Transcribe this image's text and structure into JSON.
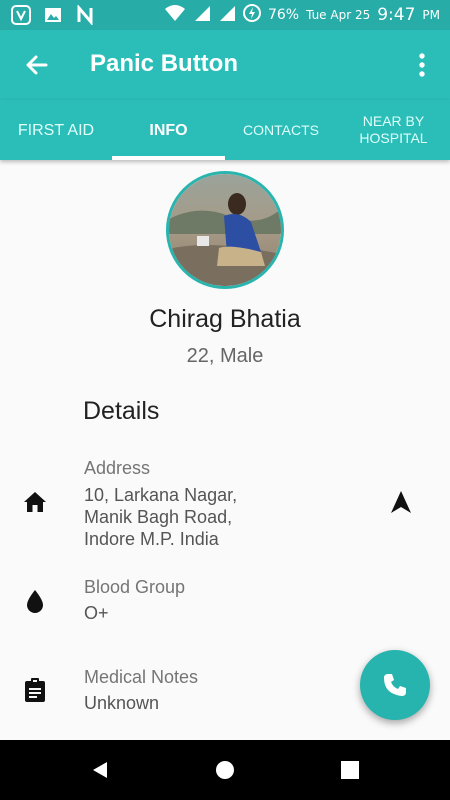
{
  "status_bar": {
    "battery": "76%",
    "date": "Tue Apr 25",
    "time": "9:47",
    "ampm": "PM"
  },
  "app_bar": {
    "title": "Panic Button"
  },
  "tabs": [
    {
      "label": "FIRST AID"
    },
    {
      "label": "INFO"
    },
    {
      "label": "CONTACTS"
    },
    {
      "label": "NEAR BY HOSPITAL"
    }
  ],
  "profile": {
    "name": "Chirag Bhatia",
    "age_gender": "22, Male"
  },
  "details": {
    "heading": "Details",
    "address": {
      "label": "Address",
      "value": "10, Larkana Nagar, Manik Bagh Road, Indore M.P. India"
    },
    "blood_group": {
      "label": "Blood Group",
      "value": "O+"
    },
    "medical_notes": {
      "label": "Medical Notes",
      "value": "Unknown"
    }
  },
  "colors": {
    "accent": "#2bbdb7",
    "status_bar": "#27aca8"
  }
}
